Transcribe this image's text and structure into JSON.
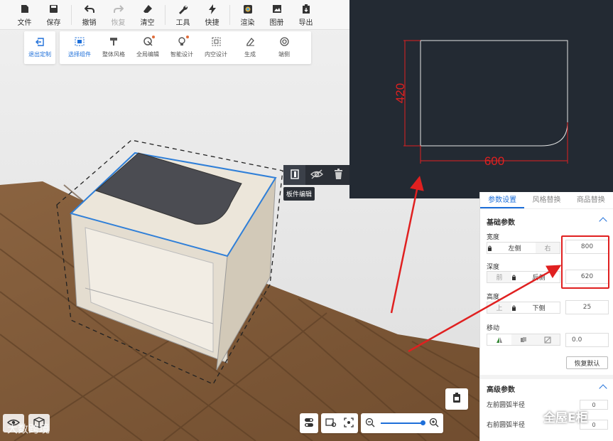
{
  "toolbar": {
    "items": [
      {
        "label": "文件",
        "icon": "file-icon"
      },
      {
        "label": "保存",
        "icon": "save-icon"
      },
      {
        "label": "撤销",
        "icon": "undo-icon"
      },
      {
        "label": "恢复",
        "icon": "redo-icon"
      },
      {
        "label": "清空",
        "icon": "eraser-icon"
      },
      {
        "label": "工具",
        "icon": "wrench-icon"
      },
      {
        "label": "快捷",
        "icon": "lightning-icon"
      },
      {
        "label": "渲染",
        "icon": "render-icon"
      },
      {
        "label": "图册",
        "icon": "album-icon"
      },
      {
        "label": "导出",
        "icon": "export-icon"
      }
    ]
  },
  "subtoolbar": {
    "exit_label": "退出定制",
    "items": [
      {
        "label": "选择组件"
      },
      {
        "label": "整体风格"
      },
      {
        "label": "全局编辑"
      },
      {
        "label": "智能设计"
      },
      {
        "label": "内空设计"
      },
      {
        "label": "生成"
      },
      {
        "label": "端侧"
      }
    ]
  },
  "cad": {
    "height_label": "420",
    "width_label": "600"
  },
  "floating_tool": {
    "tooltip": "板件编辑"
  },
  "panel": {
    "tabs": [
      "参数设置",
      "风格替换",
      "商品替换"
    ],
    "basic_title": "基础参数",
    "width_label": "宽度",
    "width_left": "左侧",
    "width_right": "右",
    "width_value": "800",
    "depth_label": "深度",
    "depth_front": "前",
    "depth_back": "后侧",
    "depth_value": "620",
    "height_label": "高度",
    "height_top": "上",
    "height_bottom": "下侧",
    "height_value": "25",
    "move_label": "移动",
    "move_value": "0.0",
    "restore_label": "恢复默认",
    "advanced_title": "高级参数",
    "left_radius_label": "左前圆弧半径",
    "left_radius_value": "0",
    "right_radius_label": "右前圆弧半径",
    "right_radius_value": "0"
  },
  "watermark": "大数跨境",
  "wechat_label": "全屋E柜",
  "colors": {
    "accent": "#1e6fd9",
    "annotation_red": "#e02020",
    "cad_bg": "#232a33"
  }
}
